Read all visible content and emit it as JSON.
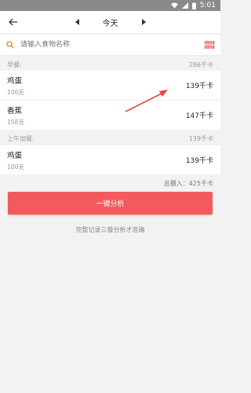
{
  "status": {
    "time": "5:01"
  },
  "header": {
    "date_label": "今天"
  },
  "search": {
    "placeholder": "请输入食物名称"
  },
  "meals": [
    {
      "name": "早餐:",
      "total": "286千卡",
      "items": [
        {
          "name": "鸡蛋",
          "qty": "100克",
          "kcal": "139千卡"
        },
        {
          "name": "香蕉",
          "qty": "158克",
          "kcal": "147千卡"
        }
      ]
    },
    {
      "name": "上午加餐:",
      "total": "139千卡",
      "items": [
        {
          "name": "鸡蛋",
          "qty": "100克",
          "kcal": "139千卡"
        }
      ]
    }
  ],
  "summary": {
    "total_intake": "总摄入：425千卡"
  },
  "analyze_button": "一键分析",
  "tip": "完整记录三餐分析才准确",
  "colors": {
    "accent": "#f35a5e",
    "search_icon": "#f07f2d",
    "statusbar": "#8a8a8a"
  }
}
